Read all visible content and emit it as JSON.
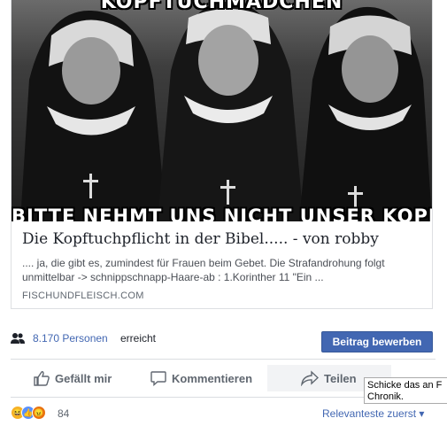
{
  "link_preview": {
    "image_top_text": "KOPFTUCHMÄDCHEN",
    "image_bottom_text": "BITTE NEHMT UNS NICHT UNSER KOPFTUCH!",
    "title": "Die Kopftuchpflicht in der Bibel..... - von robby",
    "description": ".... ja, die gibt es, zumindest für Frauen beim Gebet. Die Strafandrohung folgt unmittelbar -> schnippschnapp-Haare-ab : 1.Korinther 11 \"Ein ...",
    "domain": "FISCHUNDFLEISCH.COM"
  },
  "reach": {
    "count": "8.170 Personen",
    "suffix": "erreicht",
    "icon": "people-icon"
  },
  "boost_button": "Beitrag bewerben",
  "actions": {
    "like": "Gefällt mir",
    "comment": "Kommentieren",
    "share": "Teilen"
  },
  "tooltip": {
    "line1": "Schicke das an F",
    "line2": "Chronik."
  },
  "reactions": {
    "icons": [
      "haha-icon",
      "like-icon",
      "angry-icon"
    ],
    "count": "84",
    "sort_label": "Relevanteste zuerst ▾"
  },
  "colors": {
    "link_blue": "#4267b2",
    "button_blue": "#4267b2",
    "secondary_text": "#606770"
  }
}
